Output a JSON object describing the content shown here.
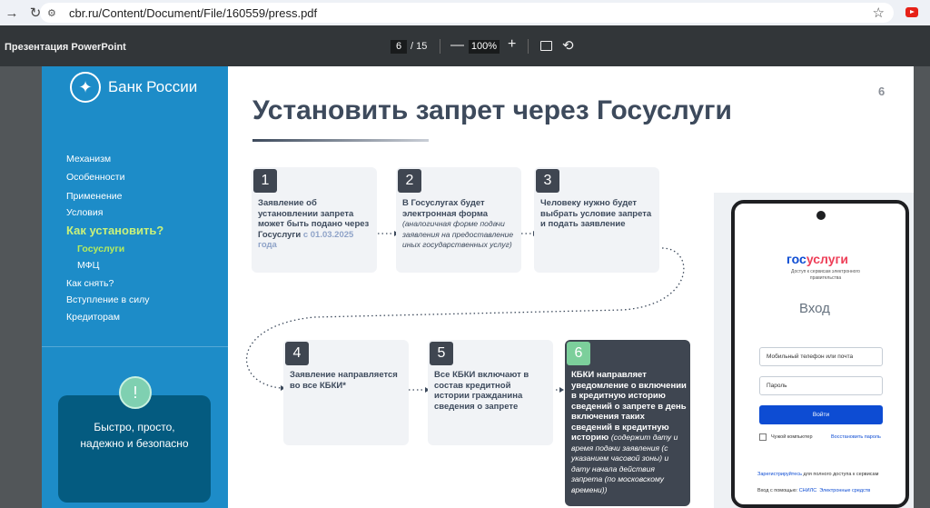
{
  "browser": {
    "url": "cbr.ru/Content/Document/File/160559/press.pdf"
  },
  "pdf_toolbar": {
    "title": "Презентация PowerPoint",
    "current_page": "6",
    "total_pages": "/ 15",
    "zoom": "100%",
    "zoom_minus": "—",
    "zoom_plus": "+"
  },
  "sidebar": {
    "logo_text": "Банк России",
    "items": [
      {
        "label": "Механизм"
      },
      {
        "label": "Особенности"
      },
      {
        "label": "Применение"
      },
      {
        "label": "Условия"
      },
      {
        "label": "Как установить?"
      },
      {
        "label": "Госуслуги"
      },
      {
        "label": "МФЦ"
      },
      {
        "label": "Как снять?"
      },
      {
        "label": "Вступление в силу"
      },
      {
        "label": "Кредиторам"
      }
    ],
    "promo_badge": "!",
    "promo_line1": "Быстро, просто,",
    "promo_line2": "надежно и безопасно"
  },
  "slide": {
    "page_number": "6",
    "title": "Установить запрет через Госуслуги",
    "steps": [
      {
        "num": "1",
        "text": "Заявление об установлении запрета может быть подано через Госуслуги",
        "accent": "с 01.03.2025 года"
      },
      {
        "num": "2",
        "text": "В Госуслугах будет электронная форма",
        "note": "(аналогичная форме подачи заявления на предоставление иных государственных услуг)"
      },
      {
        "num": "3",
        "text": "Человеку нужно будет выбрать условие запрета и подать заявление"
      },
      {
        "num": "4",
        "text": "Заявление направляется во все КБКИ*"
      },
      {
        "num": "5",
        "text": "Все КБКИ включают в состав кредитной истории гражданина сведения о запрете"
      },
      {
        "num": "6",
        "text": "КБКИ направляет уведомление о включении в кредитную историю сведений о запрете в день включения таких сведений в кредитную историю",
        "note": "(содержит дату и время подачи заявления (с указанием часовой зоны) и дату начала действия запрета (по московскому времени))"
      }
    ]
  },
  "phone": {
    "logo_part1": "гос",
    "logo_part2": "услуги",
    "subtitle": "Доступ к сервисам электронного правительства",
    "login_title": "Вход",
    "phone_placeholder": "Мобильный телефон или почта",
    "password_placeholder": "Пароль",
    "login_button": "Войти",
    "foreign_computer": "Чужой компьютер",
    "restore_password": "Восстановить пароль",
    "register_link": "Зарегистрируйтесь",
    "register_rest": " для полного доступа к сервисам",
    "alt_login_prefix": "Вход с помощью: ",
    "alt_snils": "СНИЛС",
    "alt_es": "Электронные средств"
  },
  "colors": {
    "sidebar_bg": "#1d8cc8",
    "accent_green": "#7ccf9b",
    "dark_step": "#3f4651",
    "gosuslugi_blue": "#0d4cd3"
  }
}
